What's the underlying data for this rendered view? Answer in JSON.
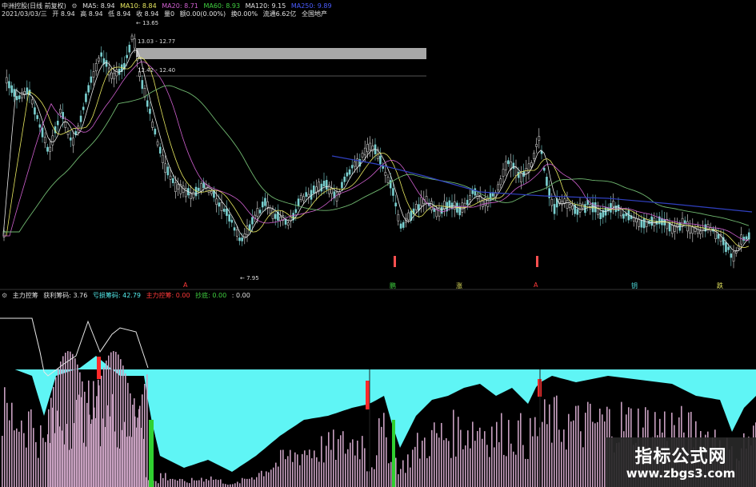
{
  "header": {
    "stock_name": "中洲控股(日线 前复权)",
    "icon": "gear-icon",
    "ma5": "MA5: 8.94",
    "ma10": "MA10: 8.84",
    "ma20": "MA20: 8.71",
    "ma60": "MA60: 8.93",
    "ma120": "MA120: 9.15",
    "ma250": "MA250: 9.89"
  },
  "quote": {
    "date": "2021/03/03/三",
    "open": "开 8.94",
    "high": "高 8.94",
    "low": "低 8.94",
    "close": "收 8.94",
    "volume": "量0",
    "change": "额0.00(0.00%)",
    "turnover": "换0.00%",
    "float_cap": "流通6.62亿",
    "sector": "全国地产"
  },
  "price_labels": {
    "high": "13.65",
    "band_upper": "13.03 - 12.77",
    "band_lower": "12.42 - 12.40",
    "low": "7.95"
  },
  "signal_labels": [
    "A",
    "鹏",
    "涨",
    "A",
    "钥",
    "跌"
  ],
  "indicator": {
    "name": "主力控筹",
    "profit_chips": "获利筹码: 3.76",
    "trapped_chips": "亏损筹码: 42.79",
    "main_control": "主力控筹: 0.00",
    "bottom_catch": "抄底: 0.00",
    "extra": ": 0.00"
  },
  "watermark": {
    "title": "指标公式网",
    "url": "www.zbgs3.com"
  },
  "colors": {
    "background": "#000000",
    "up_candle": "#e8e8e8",
    "cyan_fill": "#5ff5f5",
    "volume_bar": "#c8a0c0",
    "red_signal": "#ff2a2a",
    "green_signal": "#30d030"
  }
}
